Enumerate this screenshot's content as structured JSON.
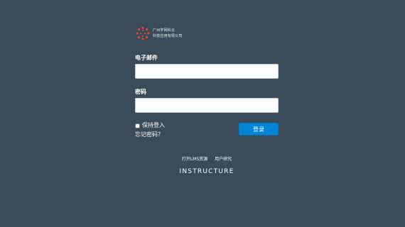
{
  "logo": {
    "icon": "canvas-logo-icon",
    "line1": "广州学网科云",
    "line2": "科技应用有限公司"
  },
  "form": {
    "email_label": "电子邮件",
    "email_value": "",
    "password_label": "密码",
    "password_value": "",
    "remember_label": "保持登入",
    "remember_checked": false,
    "forgot_label": "忘记密码？",
    "login_label": "登录"
  },
  "footer": {
    "links": [
      "打开LMS资源",
      "用户研究"
    ],
    "brand": "INSTRUCTURE"
  },
  "colors": {
    "background": "#394b58",
    "button": "#0084d6",
    "logo": "#d64a37"
  }
}
